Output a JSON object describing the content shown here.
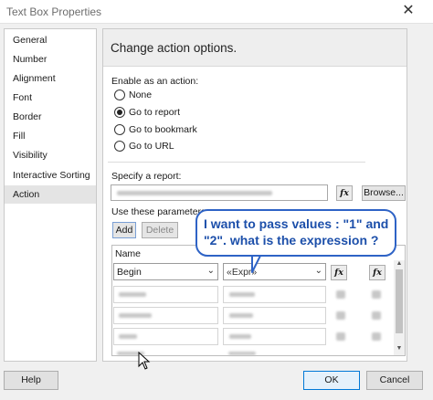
{
  "window": {
    "title": "Text Box Properties",
    "close_glyph": "✕"
  },
  "sidebar": {
    "items": [
      {
        "label": "General"
      },
      {
        "label": "Number"
      },
      {
        "label": "Alignment"
      },
      {
        "label": "Font"
      },
      {
        "label": "Border"
      },
      {
        "label": "Fill"
      },
      {
        "label": "Visibility"
      },
      {
        "label": "Interactive Sorting"
      },
      {
        "label": "Action"
      }
    ],
    "selected": "Action"
  },
  "panel": {
    "heading": "Change action options.",
    "enable_label": "Enable as an action:",
    "options": [
      {
        "label": "None",
        "checked": false
      },
      {
        "label": "Go to report",
        "checked": true
      },
      {
        "label": "Go to bookmark",
        "checked": false
      },
      {
        "label": "Go to URL",
        "checked": false
      }
    ],
    "specify_label": "Specify a report:",
    "fx_label": "fx",
    "browse_label": "Browse...",
    "params_label": "Use these parameters",
    "add_label": "Add",
    "delete_label": "Delete",
    "name_header": "Name",
    "param_row": {
      "name": "Begin",
      "value": "«Expr»"
    }
  },
  "annotation": {
    "text": "I want to pass values : \"1\" and \"2\".  what is the expression ?"
  },
  "footer": {
    "help_label": "Help",
    "ok_label": "OK",
    "cancel_label": "Cancel"
  },
  "colors": {
    "annotation_border": "#2e63c6",
    "annotation_text": "#1c4faa",
    "selection": "#e4e4e4"
  },
  "icons": {
    "close": "close-icon",
    "dropdown": "chevron-down-icon",
    "cursor": "mouse-pointer-icon"
  }
}
